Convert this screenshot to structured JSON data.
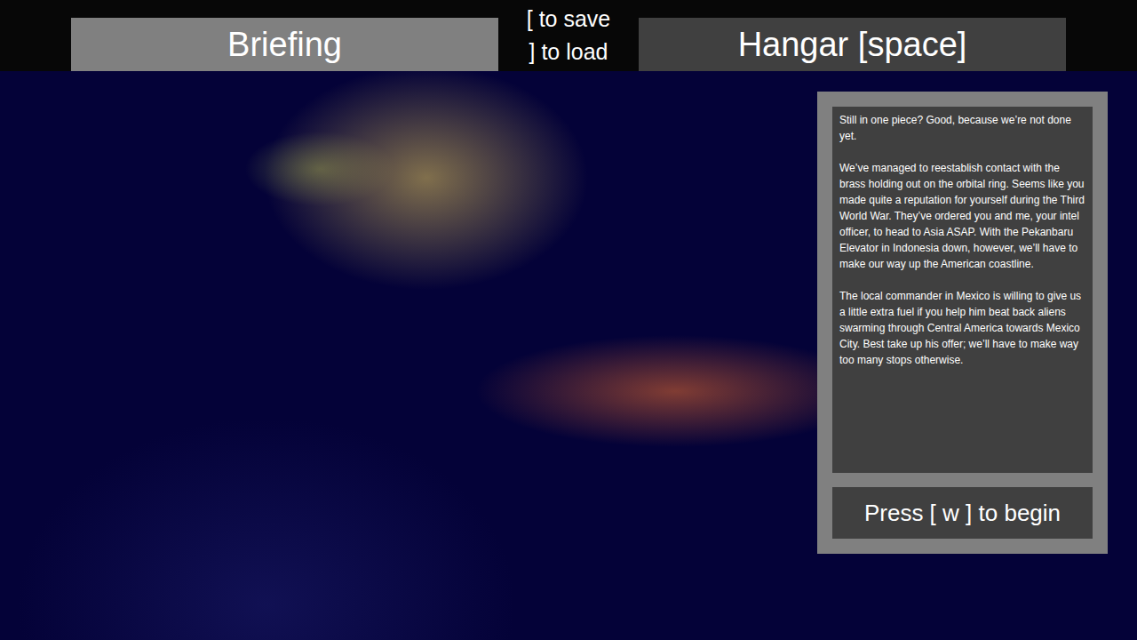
{
  "tabs": [
    {
      "label": "Briefing",
      "selected": true
    },
    {
      "label": "Hangar [space]",
      "selected": false
    }
  ],
  "hints": [
    "[ to save",
    "] to load"
  ],
  "briefing": {
    "paragraphs": [
      "Still in one piece? Good, because we’re not done yet.",
      "We’ve managed to reestablish contact with the brass holding out on the orbital ring. Seems like you made quite a reputation for yourself during the Third World War. They’ve ordered you and me, your intel officer, to head to Asia ASAP. With the Pekanbaru Elevator in Indonesia down, however, we’ll have to make our way up the American coastline.",
      "The local commander in Mexico is willing to give us a little extra fuel if you help him beat back aliens swarming through Central America towards Mexico City. Best take up his offer; we’ll have to make way too many stops otherwise."
    ]
  },
  "begin_button": {
    "label": "Press [ w ] to begin"
  }
}
